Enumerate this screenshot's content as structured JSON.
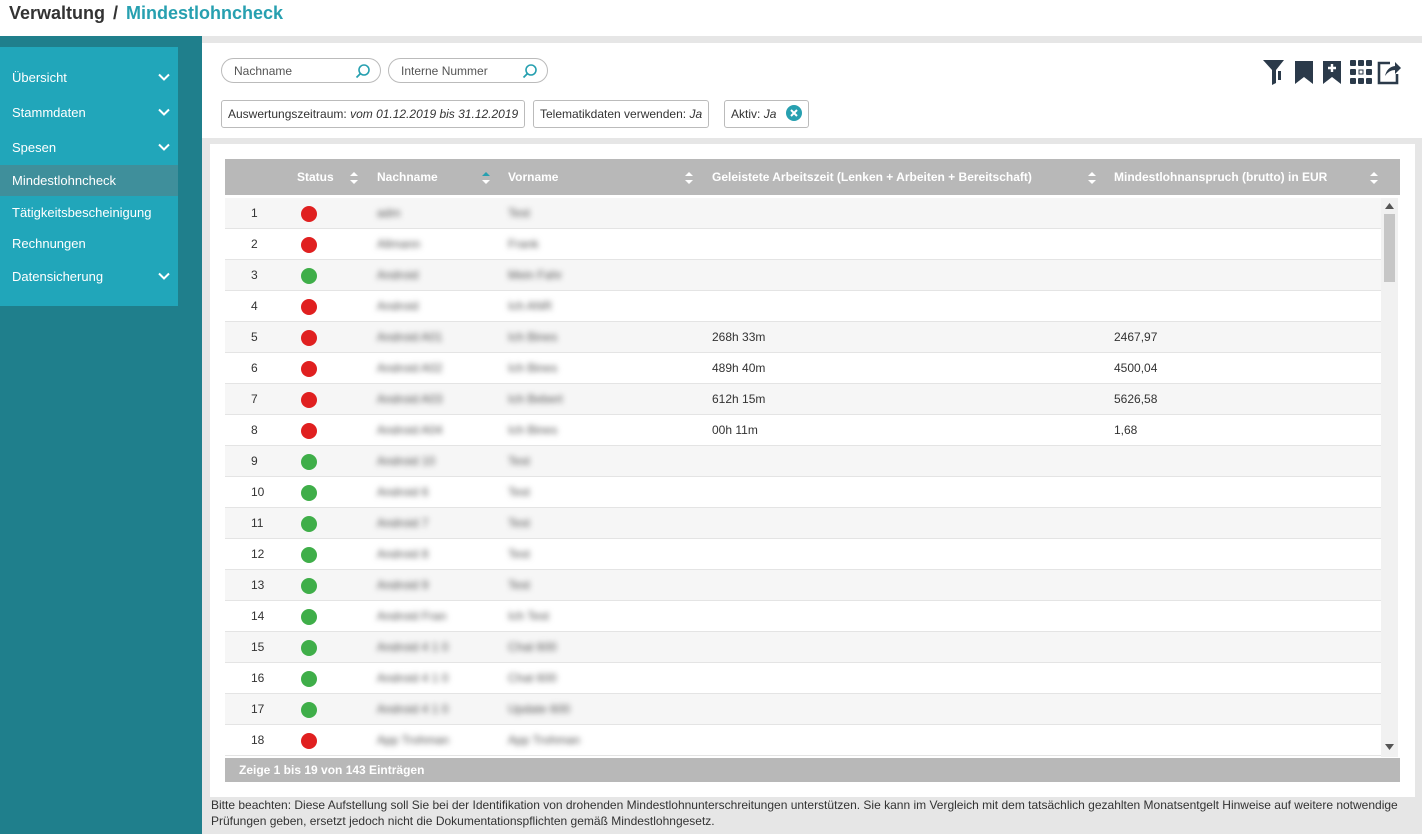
{
  "breadcrumb": {
    "parent": "Verwaltung",
    "separator": "/",
    "current": "Mindestlohncheck"
  },
  "sidebar": {
    "items": [
      {
        "label": "Übersicht",
        "has_chevron": true
      },
      {
        "label": "Stammdaten",
        "has_chevron": true
      },
      {
        "label": "Spesen",
        "has_chevron": true
      },
      {
        "label": "Mindestlohncheck",
        "has_chevron": false,
        "active": true
      },
      {
        "label": "Tätigkeitsbescheinigung",
        "has_chevron": false
      },
      {
        "label": "Rechnungen",
        "has_chevron": false
      },
      {
        "label": "Datensicherung",
        "has_chevron": true
      }
    ]
  },
  "search": {
    "nachname_placeholder": "Nachname",
    "interne_nummer_placeholder": "Interne Nummer"
  },
  "filters": {
    "zeitraum_label": "Auswertungszeitraum:",
    "zeitraum_value": "vom 01.12.2019 bis 31.12.2019",
    "telematik_label": "Telematikdaten verwenden:",
    "telematik_value": "Ja",
    "aktiv_label": "Aktiv:",
    "aktiv_value": "Ja"
  },
  "toolbar": {
    "icons": [
      "filter-icon",
      "bookmark-icon",
      "bookmark-add-icon",
      "column-grid-icon",
      "export-icon"
    ]
  },
  "colors": {
    "accent": "#27a0b0",
    "sidebar": "#21a6ba",
    "sidebar_bg": "#1f7f8c",
    "status_red": "#e02020",
    "status_green": "#3fae49",
    "header_gray": "#b8b8b8"
  },
  "table": {
    "columns": {
      "status": "Status",
      "nachname": "Nachname",
      "vorname": "Vorname",
      "arbeitszeit": "Geleistete Arbeitszeit (Lenken + Arbeiten + Bereitschaft)",
      "anspruch": "Mindestlohnanspruch (brutto) in EUR"
    },
    "rows": [
      {
        "nr": "1",
        "status": "red",
        "nachname": "adm",
        "vorname": "Test",
        "zeit": "",
        "eur": ""
      },
      {
        "nr": "2",
        "status": "red",
        "nachname": "Allmann",
        "vorname": "Frank",
        "zeit": "",
        "eur": ""
      },
      {
        "nr": "3",
        "status": "green",
        "nachname": "Android",
        "vorname": "Mein Fahr",
        "zeit": "",
        "eur": ""
      },
      {
        "nr": "4",
        "status": "red",
        "nachname": "Android",
        "vorname": "Ich ANR",
        "zeit": "",
        "eur": ""
      },
      {
        "nr": "5",
        "status": "red",
        "nachname": "Android A01",
        "vorname": "Ich Bines",
        "zeit": "268h 33m",
        "eur": "2467,97"
      },
      {
        "nr": "6",
        "status": "red",
        "nachname": "Android A02",
        "vorname": "Ich Bines",
        "zeit": "489h 40m",
        "eur": "4500,04"
      },
      {
        "nr": "7",
        "status": "red",
        "nachname": "Android A03",
        "vorname": "Ich Bebert",
        "zeit": "612h 15m",
        "eur": "5626,58"
      },
      {
        "nr": "8",
        "status": "red",
        "nachname": "Android A04",
        "vorname": "Ich Bines",
        "zeit": "00h 11m",
        "eur": "1,68"
      },
      {
        "nr": "9",
        "status": "green",
        "nachname": "Android 10",
        "vorname": "Test",
        "zeit": "",
        "eur": ""
      },
      {
        "nr": "10",
        "status": "green",
        "nachname": "Android 6",
        "vorname": "Test",
        "zeit": "",
        "eur": ""
      },
      {
        "nr": "11",
        "status": "green",
        "nachname": "Android 7",
        "vorname": "Test",
        "zeit": "",
        "eur": ""
      },
      {
        "nr": "12",
        "status": "green",
        "nachname": "Android 8",
        "vorname": "Test",
        "zeit": "",
        "eur": ""
      },
      {
        "nr": "13",
        "status": "green",
        "nachname": "Android 9",
        "vorname": "Test",
        "zeit": "",
        "eur": ""
      },
      {
        "nr": "14",
        "status": "green",
        "nachname": "Android Fran",
        "vorname": "Ich Test",
        "zeit": "",
        "eur": ""
      },
      {
        "nr": "15",
        "status": "green",
        "nachname": "Android 4 1 0",
        "vorname": "Chat 600",
        "zeit": "",
        "eur": ""
      },
      {
        "nr": "16",
        "status": "green",
        "nachname": "Android 4 1 0",
        "vorname": "Chat 600",
        "zeit": "",
        "eur": ""
      },
      {
        "nr": "17",
        "status": "green",
        "nachname": "Android 4 1 0",
        "vorname": "Update 600",
        "zeit": "",
        "eur": ""
      },
      {
        "nr": "18",
        "status": "red",
        "nachname": "App Trohman",
        "vorname": "App Trohman",
        "zeit": "",
        "eur": ""
      }
    ],
    "footer": "Zeige 1 bis 19 von 143 Einträgen"
  },
  "note": "Bitte beachten: Diese Aufstellung soll Sie bei der Identifikation von drohenden Mindestlohnunterschreitungen unterstützen. Sie kann im Vergleich mit dem tatsächlich gezahlten Monatsentgelt Hinweise auf weitere notwendige Prüfungen geben, ersetzt jedoch nicht die Dokumentationspflichten gemäß Mindestlohngesetz."
}
